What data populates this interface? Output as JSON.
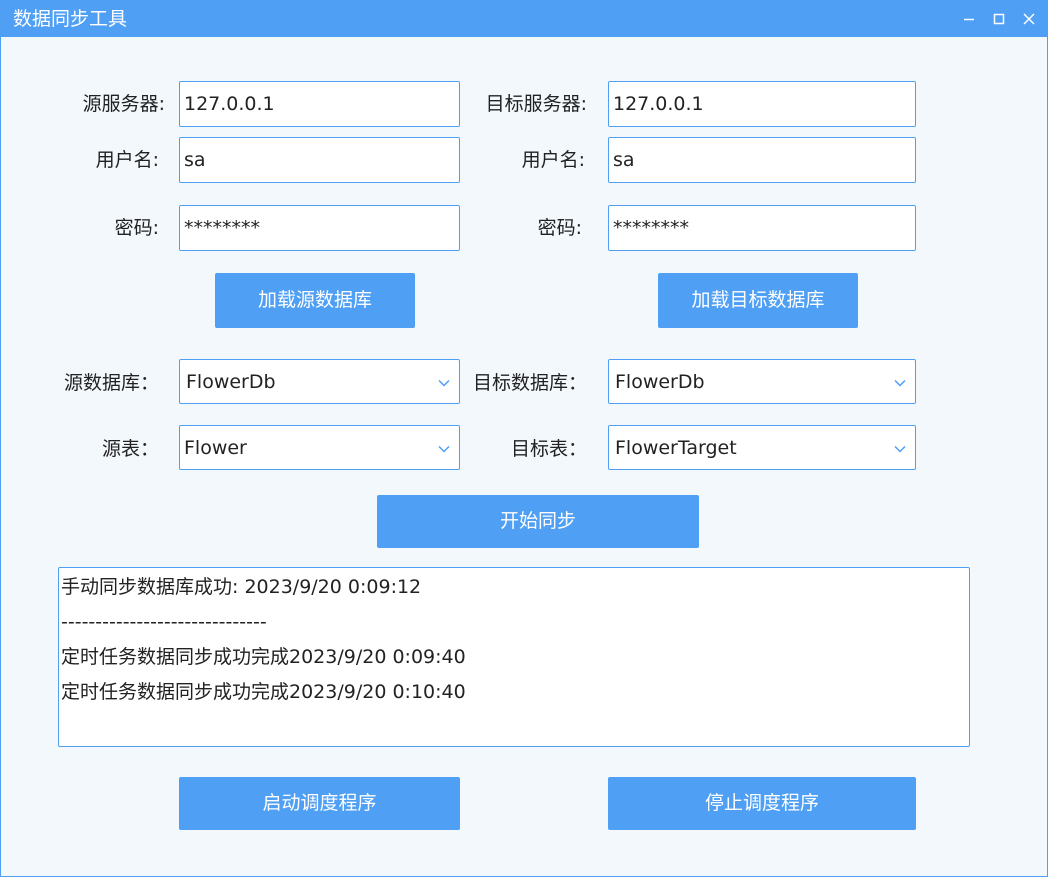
{
  "window": {
    "title": "数据同步工具",
    "controls": [
      "minimize",
      "maximize",
      "close"
    ]
  },
  "source": {
    "server_label": "源服务器:",
    "server_value": "127.0.0.1",
    "user_label": "用户名:",
    "user_value": "sa",
    "password_label": "密码:",
    "password_value": "********",
    "load_button": "加载源数据库",
    "database_label": "源数据库：",
    "database_value": "FlowerDb",
    "table_label": "源表：",
    "table_value": "Flower"
  },
  "target": {
    "server_label": "目标服务器:",
    "server_value": "127.0.0.1",
    "user_label": "用户名:",
    "user_value": "sa",
    "password_label": "密码:",
    "password_value": "********",
    "load_button": "加载目标数据库",
    "database_label": "目标数据库：",
    "database_value": "FlowerDb",
    "table_label": "目标表：",
    "table_value": "FlowerTarget"
  },
  "sync_button": "开始同步",
  "log": {
    "lines": [
      "手动同步数据库成功: 2023/9/20 0:09:12",
      "------------------------------",
      "定时任务数据同步成功完成2023/9/20 0:09:40",
      "定时任务数据同步成功完成2023/9/20 0:10:40"
    ]
  },
  "scheduler": {
    "start_button": "启动调度程序",
    "stop_button": "停止调度程序"
  },
  "colors": {
    "accent": "#4f9ff5",
    "background": "#f3f8fd",
    "text": "#222222"
  }
}
